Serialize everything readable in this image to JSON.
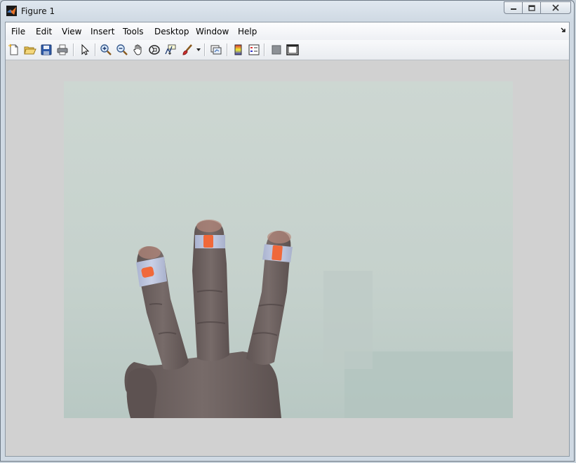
{
  "window": {
    "title": "Figure 1",
    "icon": "matlab-logo-icon"
  },
  "caption_buttons": [
    {
      "name": "minimize-button",
      "icon": "minimize-icon"
    },
    {
      "name": "maximize-button",
      "icon": "maximize-icon"
    },
    {
      "name": "close-button",
      "icon": "close-icon"
    }
  ],
  "menu": {
    "items": [
      "File",
      "Edit",
      "View",
      "Insert",
      "Tools",
      "Desktop",
      "Window",
      "Help"
    ],
    "dock_icon": "dock-arrow-icon"
  },
  "toolbar": {
    "icons": [
      "new-figure-icon",
      "open-file-icon",
      "save-icon",
      "print-icon",
      "edit-plot-icon",
      "zoom-in-icon",
      "zoom-out-icon",
      "pan-icon",
      "rotate-3d-icon",
      "data-cursor-icon",
      "brush-icon",
      "link-plot-icon",
      "insert-colorbar-icon",
      "insert-legend-icon",
      "hide-plot-tools-icon",
      "show-plot-tools-icon"
    ]
  },
  "figure": {
    "image_content": "photo-of-hand-with-three-raised-fingers",
    "colors": {
      "background_wall": "#c7d2ce",
      "skin": "#6f6462",
      "tape": "#b9c1dc",
      "marker": "#f0683a"
    }
  }
}
